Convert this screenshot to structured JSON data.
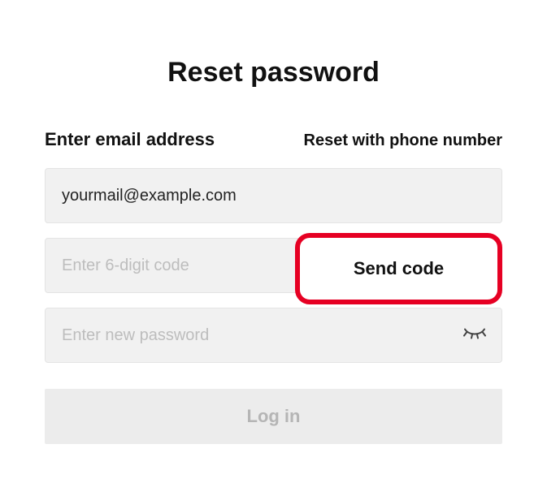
{
  "title": "Reset password",
  "subtitle": "Enter email address",
  "altLink": "Reset with phone number",
  "email": {
    "value": "yourmail@example.com",
    "placeholder": ""
  },
  "code": {
    "value": "",
    "placeholder": "Enter 6-digit code"
  },
  "sendCodeLabel": "Send code",
  "password": {
    "value": "",
    "placeholder": "Enter new password"
  },
  "loginLabel": "Log in"
}
